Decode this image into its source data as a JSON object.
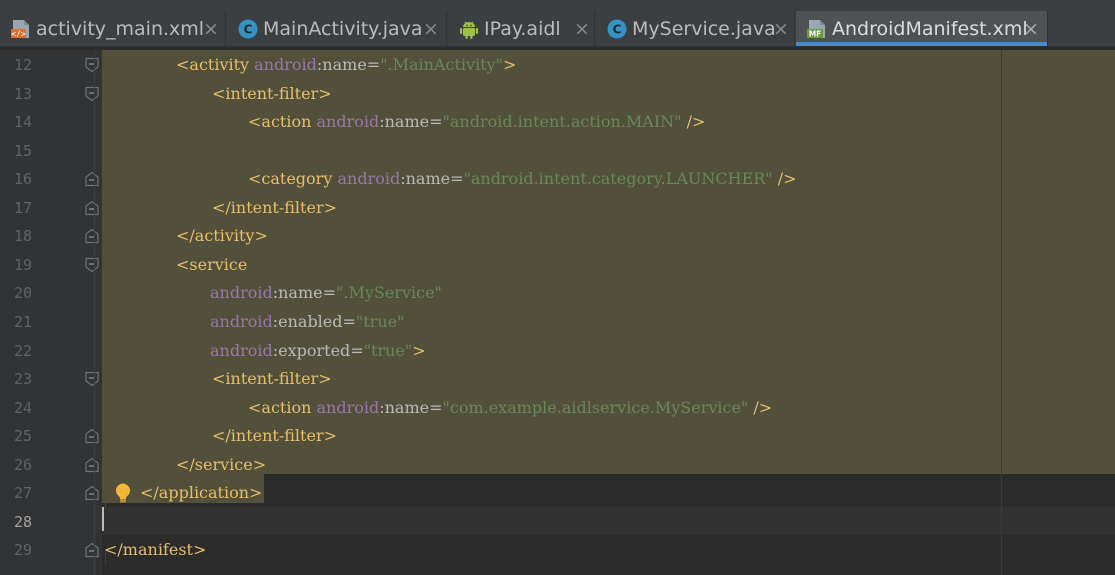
{
  "tabs": [
    {
      "label": "activity_main.xml",
      "icon": "layout-xml-icon",
      "active": false
    },
    {
      "label": "MainActivity.java",
      "icon": "java-class-icon",
      "active": false
    },
    {
      "label": "IPay.aidl",
      "icon": "android-icon",
      "active": false
    },
    {
      "label": "MyService.java",
      "icon": "java-class-icon",
      "active": false
    },
    {
      "label": "AndroidManifest.xml",
      "icon": "manifest-icon",
      "active": true
    }
  ],
  "close_glyph": "×",
  "editor": {
    "current_line": 28,
    "lines": [
      {
        "number": "12",
        "tokens": [
          {
            "t": "<",
            "c": "bracket"
          },
          {
            "t": "activity",
            "c": "tag"
          },
          {
            "t": " ",
            "c": "plain"
          },
          {
            "t": "android",
            "c": "ns"
          },
          {
            "t": ":name=",
            "c": "attr"
          },
          {
            "t": "\".MainActivity\"",
            "c": "val"
          },
          {
            "t": ">",
            "c": "bracket"
          }
        ]
      },
      {
        "number": "13",
        "tokens": [
          {
            "t": "<",
            "c": "bracket"
          },
          {
            "t": "intent-filter",
            "c": "tag"
          },
          {
            "t": ">",
            "c": "bracket"
          }
        ]
      },
      {
        "number": "14",
        "tokens": [
          {
            "t": "<",
            "c": "bracket"
          },
          {
            "t": "action",
            "c": "tag"
          },
          {
            "t": " ",
            "c": "plain"
          },
          {
            "t": "android",
            "c": "ns"
          },
          {
            "t": ":name=",
            "c": "attr"
          },
          {
            "t": "\"android.intent.action.MAIN\"",
            "c": "val"
          },
          {
            "t": " />",
            "c": "bracket"
          }
        ]
      },
      {
        "number": "15",
        "tokens": []
      },
      {
        "number": "16",
        "tokens": [
          {
            "t": "<",
            "c": "bracket"
          },
          {
            "t": "category",
            "c": "tag"
          },
          {
            "t": " ",
            "c": "plain"
          },
          {
            "t": "android",
            "c": "ns"
          },
          {
            "t": ":name=",
            "c": "attr"
          },
          {
            "t": "\"android.intent.category.LAUNCHER\"",
            "c": "val"
          },
          {
            "t": " />",
            "c": "bracket"
          }
        ]
      },
      {
        "number": "17",
        "tokens": [
          {
            "t": "</",
            "c": "bracket"
          },
          {
            "t": "intent-filter",
            "c": "tag"
          },
          {
            "t": ">",
            "c": "bracket"
          }
        ]
      },
      {
        "number": "18",
        "tokens": [
          {
            "t": "</",
            "c": "bracket"
          },
          {
            "t": "activity",
            "c": "tag"
          },
          {
            "t": ">",
            "c": "bracket"
          }
        ]
      },
      {
        "number": "19",
        "tokens": [
          {
            "t": "<",
            "c": "bracket"
          },
          {
            "t": "service",
            "c": "tag"
          }
        ]
      },
      {
        "number": "20",
        "tokens": [
          {
            "t": "android",
            "c": "ns"
          },
          {
            "t": ":name=",
            "c": "attr"
          },
          {
            "t": "\".MyService\"",
            "c": "val"
          }
        ]
      },
      {
        "number": "21",
        "tokens": [
          {
            "t": "android",
            "c": "ns"
          },
          {
            "t": ":enabled=",
            "c": "attr"
          },
          {
            "t": "\"true\"",
            "c": "val"
          }
        ]
      },
      {
        "number": "22",
        "tokens": [
          {
            "t": "android",
            "c": "ns"
          },
          {
            "t": ":exported=",
            "c": "attr"
          },
          {
            "t": "\"true\"",
            "c": "val"
          },
          {
            "t": ">",
            "c": "bracket"
          }
        ]
      },
      {
        "number": "23",
        "tokens": [
          {
            "t": "<",
            "c": "bracket"
          },
          {
            "t": "intent-filter",
            "c": "tag"
          },
          {
            "t": ">",
            "c": "bracket"
          }
        ]
      },
      {
        "number": "24",
        "tokens": [
          {
            "t": "<",
            "c": "bracket"
          },
          {
            "t": "action",
            "c": "tag"
          },
          {
            "t": " ",
            "c": "plain"
          },
          {
            "t": "android",
            "c": "ns"
          },
          {
            "t": ":name=",
            "c": "attr"
          },
          {
            "t": "\"com.example.aidlservice.MyService\"",
            "c": "val"
          },
          {
            "t": " />",
            "c": "bracket"
          }
        ]
      },
      {
        "number": "25",
        "tokens": [
          {
            "t": "</",
            "c": "bracket"
          },
          {
            "t": "intent-filter",
            "c": "tag"
          },
          {
            "t": ">",
            "c": "bracket"
          }
        ]
      },
      {
        "number": "26",
        "tokens": [
          {
            "t": "</",
            "c": "bracket"
          },
          {
            "t": "service",
            "c": "tag"
          },
          {
            "t": ">",
            "c": "bracket"
          }
        ]
      },
      {
        "number": "27",
        "tokens": [
          {
            "t": "</",
            "c": "bracket"
          },
          {
            "t": "application",
            "c": "tag"
          },
          {
            "t": ">",
            "c": "bracket"
          }
        ]
      },
      {
        "number": "28",
        "tokens": []
      },
      {
        "number": "29",
        "tokens": [
          {
            "t": "</",
            "c": "bracket"
          },
          {
            "t": "manifest",
            "c": "tag"
          },
          {
            "t": ">",
            "c": "bracket"
          }
        ]
      }
    ]
  },
  "colors": {
    "background": "#2b2b2b",
    "gutter": "#313335",
    "selection_highlight": "#52503a",
    "tag": "#e8bf6a",
    "namespace": "#9876aa",
    "attribute": "#bababa",
    "value": "#6a8759",
    "active_tab_underline": "#4a88c7"
  },
  "icons": {
    "intention_bulb": "lightbulb-icon",
    "fold": "fold-marker-icon"
  }
}
